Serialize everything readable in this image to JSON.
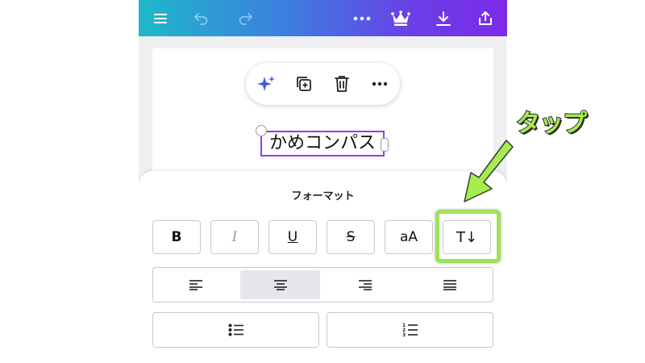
{
  "toolbar": {
    "icons": [
      "menu-icon",
      "undo-icon",
      "redo-icon",
      "more-icon",
      "crown-icon",
      "download-icon",
      "share-icon"
    ],
    "gradient": [
      "#1fb8c9",
      "#7d2ae8"
    ]
  },
  "floating_toolbar": {
    "icons": [
      "magic-sparkle-icon",
      "duplicate-icon",
      "trash-icon",
      "more-icon"
    ]
  },
  "textbox": {
    "text": "かめコンパス"
  },
  "format_sheet": {
    "title": "フォーマット",
    "buttons": [
      {
        "label": "B"
      },
      {
        "label": "I"
      },
      {
        "label": "U"
      },
      {
        "label": "S"
      },
      {
        "label": "aA"
      },
      {
        "label": "T↓"
      }
    ],
    "alignment": {
      "options": [
        "left",
        "center",
        "right",
        "justify"
      ],
      "selected": "center"
    },
    "lists": [
      "bullet-list",
      "numbered-list"
    ]
  },
  "annotation": {
    "label": "タップ",
    "color": "#9ee35a"
  },
  "colors": {
    "accent": "#8b3dff",
    "highlight": "#9ee35a"
  }
}
